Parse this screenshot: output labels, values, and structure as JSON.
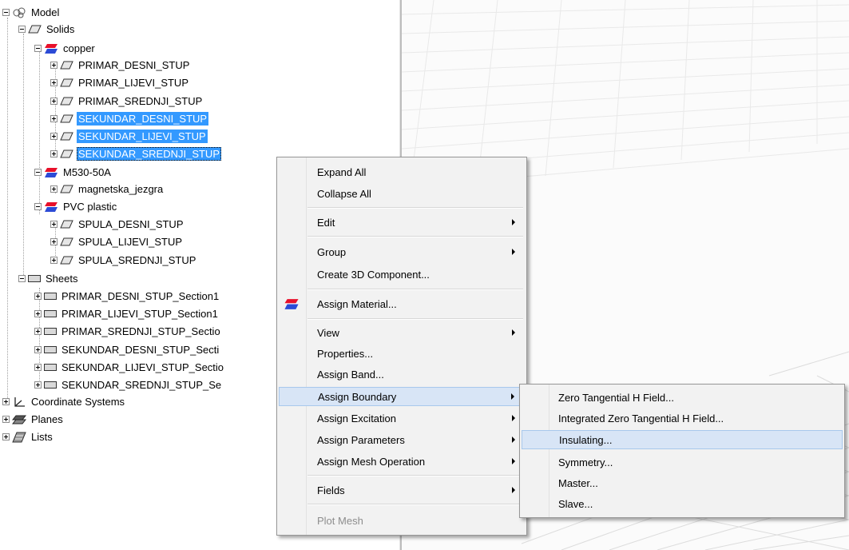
{
  "tree": {
    "model": "Model",
    "solids": "Solids",
    "copper": "copper",
    "copper_items": [
      "PRIMAR_DESNI_STUP",
      "PRIMAR_LIJEVI_STUP",
      "PRIMAR_SREDNJI_STUP",
      "SEKUNDAR_DESNI_STUP",
      "SEKUNDAR_LIJEVI_STUP",
      "SEKUNDAR_SREDNJI_STUP"
    ],
    "m530": "M530-50A",
    "m530_items": [
      "magnetska_jezgra"
    ],
    "pvc": "PVC plastic",
    "pvc_items": [
      "SPULA_DESNI_STUP",
      "SPULA_LIJEVI_STUP",
      "SPULA_SREDNJI_STUP"
    ],
    "sheets": "Sheets",
    "sheet_items": [
      "PRIMAR_DESNI_STUP_Section1",
      "PRIMAR_LIJEVI_STUP_Section1",
      "PRIMAR_SREDNJI_STUP_Sectio",
      "SEKUNDAR_DESNI_STUP_Secti",
      "SEKUNDAR_LIJEVI_STUP_Sectio",
      "SEKUNDAR_SREDNJI_STUP_Se"
    ],
    "coord": "Coordinate Systems",
    "planes": "Planes",
    "lists": "Lists"
  },
  "context_menu": {
    "items": [
      "Expand All",
      "Collapse All",
      "Edit",
      "Group",
      "Create 3D Component...",
      "Assign Material...",
      "View",
      "Properties...",
      "Assign Band...",
      "Assign Boundary",
      "Assign Excitation",
      "Assign Parameters",
      "Assign Mesh Operation",
      "Fields",
      "Plot Mesh"
    ],
    "highlighted": "Assign Boundary",
    "disabled": "Plot Mesh"
  },
  "submenu": {
    "items": [
      "Zero Tangential H Field...",
      "Integrated Zero Tangential H Field...",
      "Insulating...",
      "Symmetry...",
      "Master...",
      "Slave..."
    ],
    "highlighted": "Insulating..."
  },
  "colors": {
    "selection": "#3399ff",
    "menu_bg": "#f2f2f2",
    "menu_highlight": "#d8e5f6"
  }
}
